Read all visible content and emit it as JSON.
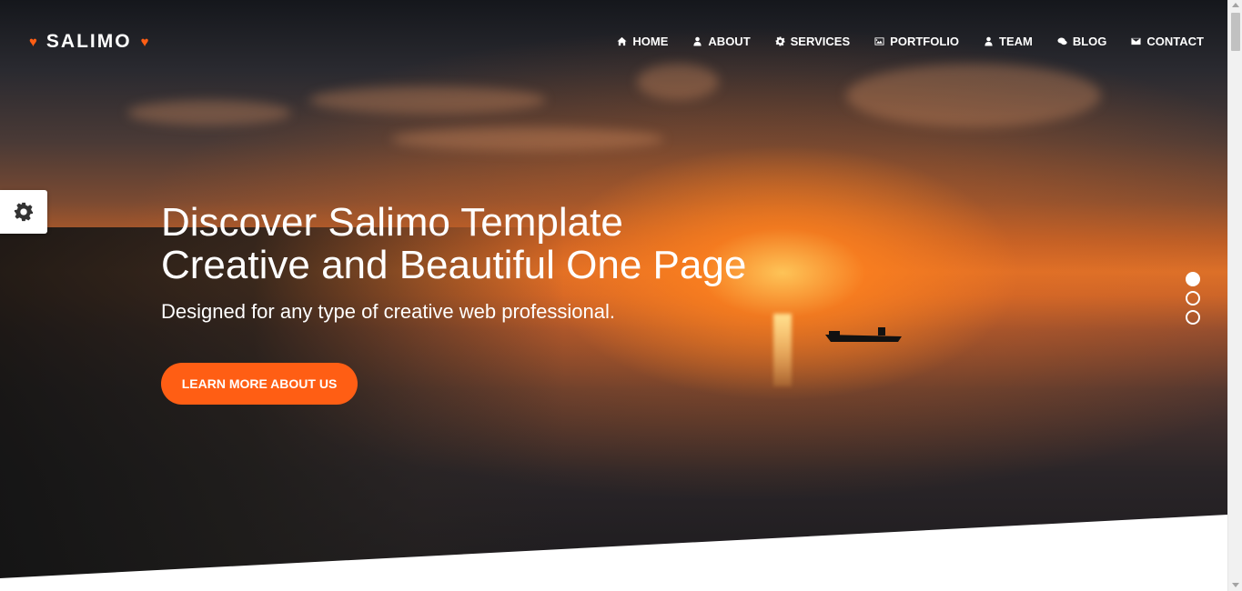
{
  "brand": {
    "name": "SALIMO",
    "left_icon": "heart-icon",
    "right_icon": "heart-icon",
    "accent": "#ff5e14"
  },
  "nav": {
    "items": [
      {
        "label": "HOME",
        "icon": "home-icon"
      },
      {
        "label": "ABOUT",
        "icon": "user-icon"
      },
      {
        "label": "SERVICES",
        "icon": "gear-icon"
      },
      {
        "label": "PORTFOLIO",
        "icon": "image-icon"
      },
      {
        "label": "TEAM",
        "icon": "user-icon"
      },
      {
        "label": "BLOG",
        "icon": "comments-icon"
      },
      {
        "label": "CONTACT",
        "icon": "envelope-icon"
      }
    ]
  },
  "settings": {
    "icon": "gear-icon"
  },
  "hero": {
    "headline_line1": "Discover Salimo Template",
    "headline_line2": "Creative and Beautiful One Page",
    "subline": "Designed for any type of creative web professional.",
    "cta_label": "LEARN MORE ABOUT US",
    "slides_total": 3,
    "active_slide": 1
  },
  "colors": {
    "cta": "#ff5e14",
    "text": "#ffffff",
    "page_bg": "#ffffff"
  }
}
